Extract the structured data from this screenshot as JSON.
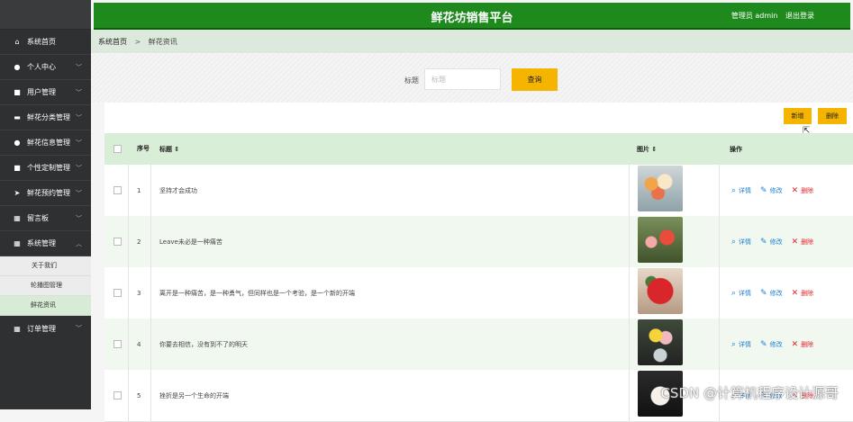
{
  "header": {
    "title": "鲜花坊销售平台",
    "user": "管理员 admin",
    "logout": "退出登录"
  },
  "sidebar": {
    "items": [
      {
        "label": "系统首页",
        "icon": "home-icon",
        "glyph": "⌂",
        "chevron": false
      },
      {
        "label": "个人中心",
        "icon": "user-icon",
        "glyph": "●",
        "chevron": true
      },
      {
        "label": "用户管理",
        "icon": "folder-icon",
        "glyph": "■",
        "chevron": true
      },
      {
        "label": "鲜花分类管理",
        "icon": "layers-icon",
        "glyph": "▬",
        "chevron": true
      },
      {
        "label": "鲜花信息管理",
        "icon": "location-icon",
        "glyph": "●",
        "chevron": true
      },
      {
        "label": "个性定制管理",
        "icon": "lock-icon",
        "glyph": "■",
        "chevron": true
      },
      {
        "label": "鲜花预约管理",
        "icon": "send-icon",
        "glyph": "➤",
        "chevron": true
      },
      {
        "label": "留言板",
        "icon": "grid-icon",
        "glyph": "▦",
        "chevron": true
      },
      {
        "label": "系统管理",
        "icon": "grid-icon",
        "glyph": "▦",
        "chevron": "up"
      }
    ],
    "submenu": [
      "关于我们",
      "轮播图管理",
      "鲜花资讯"
    ],
    "after": {
      "label": "订单管理",
      "icon": "table-icon",
      "glyph": "▦"
    }
  },
  "breadcrumb": {
    "home": "系统首页",
    "separator": ">",
    "current": "鲜花资讯"
  },
  "search": {
    "label": "标题",
    "placeholder": "标题",
    "button": "查询"
  },
  "toolbar": {
    "add": "新增",
    "delete": "删除"
  },
  "table": {
    "headers": {
      "index": "序号",
      "title": "标题 ⇕",
      "image": "图片 ⇕",
      "actions": "操作"
    },
    "action_labels": {
      "view": "详情",
      "edit": "修改",
      "remove": "删除"
    },
    "rows": [
      {
        "index": "1",
        "title": "坚持才会成功"
      },
      {
        "index": "2",
        "title": "Leave未必是一种痛苦"
      },
      {
        "index": "3",
        "title": "离开是一种痛苦，是一种勇气，但同样也是一个考验，是一个新的开端"
      },
      {
        "index": "4",
        "title": "你要去相信，没有到不了的明天"
      },
      {
        "index": "5",
        "title": "挫折是另一个生命的开端"
      }
    ]
  },
  "watermark": "CSDN @计算机程序设计源哥",
  "colors": {
    "header_green": "#1e8a1e",
    "accent_yellow": "#f4b400",
    "sidebar_dark": "#2f3031",
    "delete_red": "#e0232b",
    "link_blue": "#1e7fd0"
  }
}
